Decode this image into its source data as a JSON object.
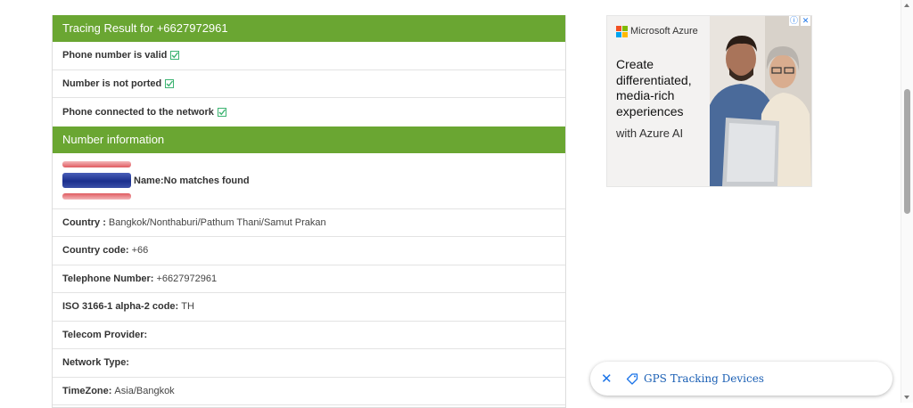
{
  "result_panel": {
    "heading": "Tracing Result for +6627972961",
    "checks": [
      {
        "label": "Phone number is valid"
      },
      {
        "label": "Number is not ported"
      },
      {
        "label": "Phone connected to the network"
      }
    ]
  },
  "info_panel": {
    "heading": "Number information",
    "name_label": "Name:",
    "name_value": "No matches found",
    "rows": [
      {
        "label": "Country :",
        "value": "Bangkok/Nonthaburi/Pathum Thani/Samut Prakan"
      },
      {
        "label": "Country code:",
        "value": "+66"
      },
      {
        "label": "Telephone Number:",
        "value": "+6627972961"
      },
      {
        "label": "ISO 3166-1 alpha-2 code:",
        "value": "TH"
      },
      {
        "label": "Telecom Provider:",
        "value": ""
      },
      {
        "label": "Network Type:",
        "value": ""
      },
      {
        "label": "TimeZone:",
        "value": "Asia/Bangkok"
      }
    ]
  },
  "ad": {
    "brand": "Microsoft Azure",
    "headline": "Create differentiated, media-rich experiences",
    "subline": "with Azure AI",
    "info_glyph": "ⓘ",
    "close_glyph": "✕"
  },
  "bottom_pill": {
    "close_glyph": "✕",
    "text": "GPS Tracking Devices"
  },
  "colors": {
    "heading_green": "#6aa632",
    "check_green": "#3cb371",
    "link_blue": "#1a73e8"
  }
}
